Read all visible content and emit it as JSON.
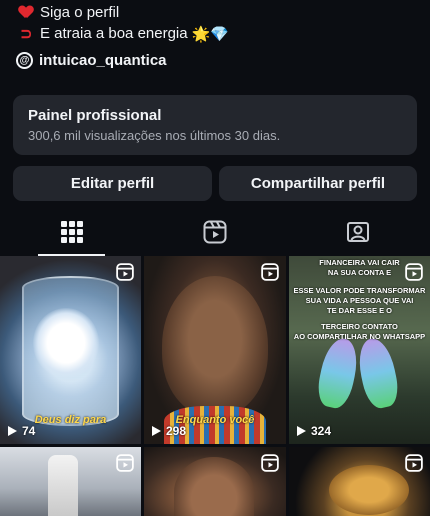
{
  "bio": {
    "line1_text": "Siga o perfil",
    "line2_text": "E atraia a boa energia",
    "line2_emojis": "🌟💎"
  },
  "threads": {
    "handle": "intuicao_quantica"
  },
  "panel": {
    "title": "Painel profissional",
    "subtitle": "300,6 mil visualizações nos últimos 30 dias."
  },
  "buttons": {
    "edit": "Editar perfil",
    "share": "Compartilhar perfil"
  },
  "tabs": [
    {
      "icon": "grid-icon",
      "active": true
    },
    {
      "icon": "reels-icon",
      "active": false
    },
    {
      "icon": "tagged-icon",
      "active": false
    }
  ],
  "posts": [
    {
      "caption": "Deus diz para",
      "views": "74"
    },
    {
      "caption": "Enquanto você",
      "views": "298"
    },
    {
      "overlay_top": [
        "FINANCEIRA VAI CAIR",
        "NA SUA CONTA E"
      ],
      "overlay_mid": [
        "ESSE VALOR PODE TRANSFORMAR",
        "SUA VIDA A PESSOA QUE VAI",
        "TE DAR ESSE E O"
      ],
      "overlay_bottom": [
        "TERCEIRO CONTATO",
        "AO COMPARTILHAR NO WHATSAPP"
      ],
      "views": "324"
    }
  ],
  "colors": {
    "background": "#0b0d12",
    "surface": "#23262d",
    "caption": "#ffd84a"
  }
}
